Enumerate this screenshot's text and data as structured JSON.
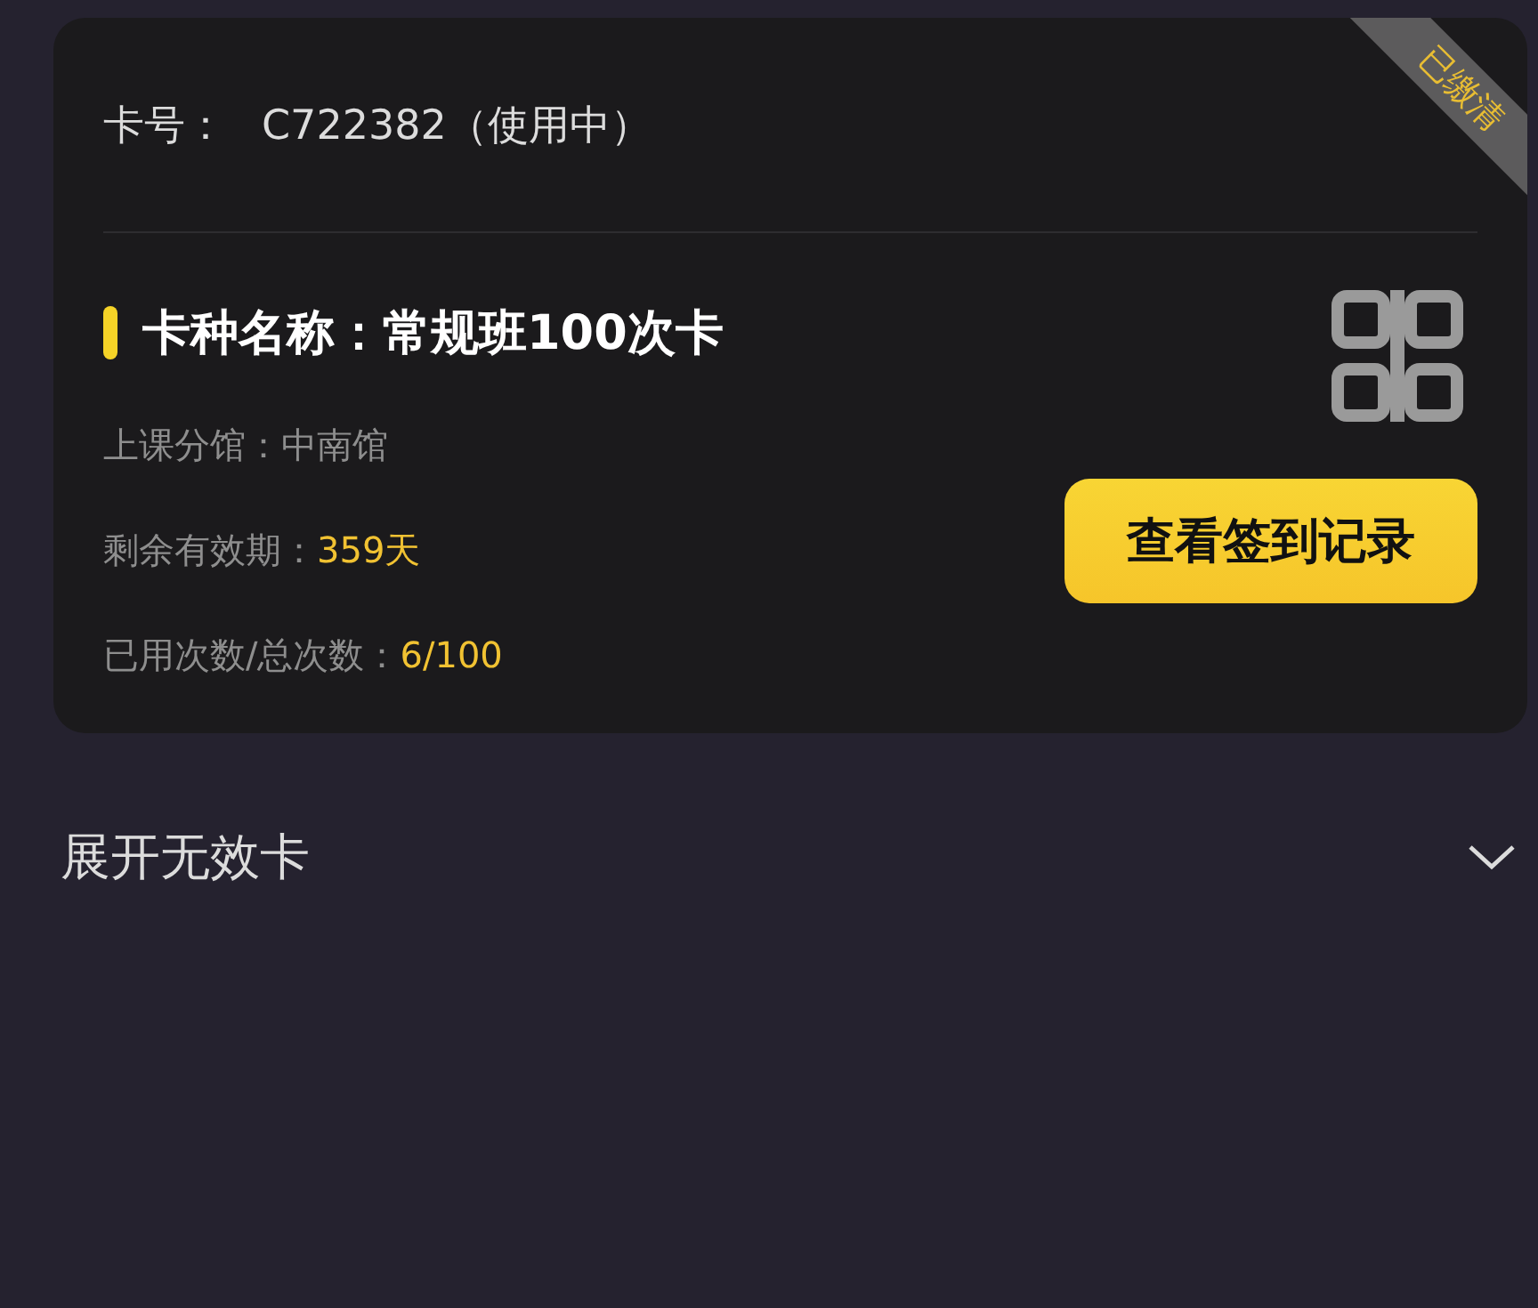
{
  "card": {
    "number_label": "卡号：",
    "number": "C722382（使用中）",
    "ribbon": "已缴清",
    "title": "卡种名称：常规班100次卡",
    "details": [
      {
        "label": "上课分馆：",
        "value": "中南馆",
        "highlight": false
      },
      {
        "label": "剩余有效期：",
        "value": "359天",
        "highlight": true
      },
      {
        "label": "已用次数/总次数：",
        "value": "6/100",
        "highlight": true
      }
    ],
    "button": "查看签到记录"
  },
  "expander": {
    "label": "展开无效卡",
    "expanded": false
  }
}
